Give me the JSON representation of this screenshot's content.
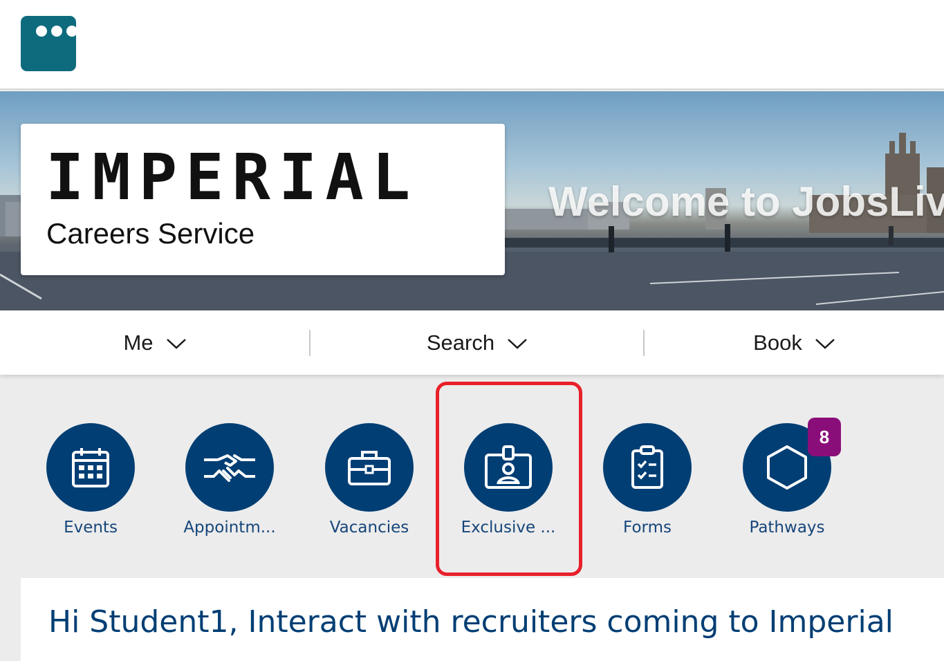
{
  "app": {
    "logo_icon": "chat-dots-icon",
    "accent_color": "#0e6b7d"
  },
  "banner": {
    "brand_title": "IMPERIAL",
    "brand_subtitle": "Careers Service",
    "welcome_text": "Welcome to JobsLive"
  },
  "nav": {
    "items": [
      {
        "label": "Me"
      },
      {
        "label": "Search"
      },
      {
        "label": "Book"
      }
    ]
  },
  "tiles": [
    {
      "label": "Events",
      "icon": "calendar-icon"
    },
    {
      "label": "Appointm...",
      "icon": "handshake-icon"
    },
    {
      "label": "Vacancies",
      "icon": "briefcase-icon"
    },
    {
      "label": "Exclusive ...",
      "icon": "id-badge-icon"
    },
    {
      "label": "Forms",
      "icon": "clipboard-check-icon"
    },
    {
      "label": "Pathways",
      "icon": "hexagon-icon",
      "badge": "8"
    }
  ],
  "colors": {
    "tile_bg": "#003e74",
    "badge_bg": "#8a0e79",
    "highlight": "#e8202a"
  },
  "greeting": "Hi Student1, Interact with recruiters coming to Imperial"
}
